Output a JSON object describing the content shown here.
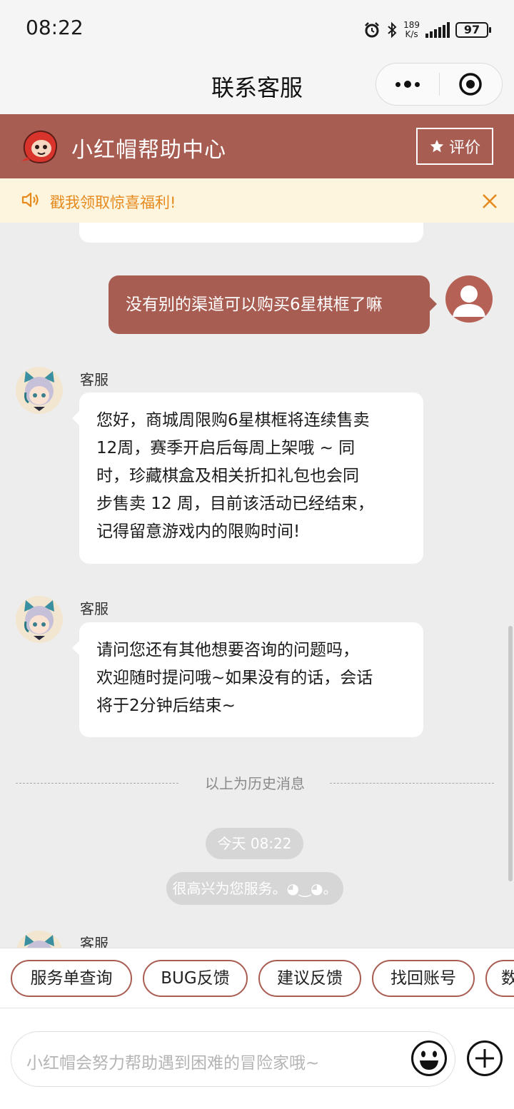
{
  "status_bar": {
    "time": "08:22",
    "net_speed_value": "189",
    "net_speed_unit": "K/s",
    "battery": "97",
    "icons": [
      "alarm-icon",
      "bluetooth-icon",
      "signal-icon",
      "battery-icon"
    ]
  },
  "title_bar": {
    "title": "联系客服",
    "icons": [
      "more-icon",
      "close-target-icon"
    ]
  },
  "brand": {
    "title": "小红帽帮助中心",
    "rate_label": "评价",
    "accent_color": "#a85d52"
  },
  "notice": {
    "text": "戳我领取惊喜福利!",
    "text_color": "#e68a1e",
    "background": "#fdf5dd"
  },
  "chat": {
    "user_message": "没有别的渠道可以购买6星棋框了嘛",
    "messages": [
      {
        "sender": "客服",
        "lines": [
          "您好，商城周限购6星棋框将连续售卖",
          "12周，赛季开启后每周上架哦 ~ 同",
          "时，珍藏棋盒及相关折扣礼包也会同",
          "步售卖 12 周，目前该活动已经结束，",
          "记得留意游戏内的限购时间!"
        ]
      },
      {
        "sender": "客服",
        "lines": [
          "请问您还有其他想要咨询的问题吗，",
          "欢迎随时提问哦~如果没有的话，会话",
          "将于2分钟后结束~"
        ]
      }
    ],
    "history_divider": "以上为历史消息",
    "time_label": "今天 08:22",
    "greeting": "很高兴为您服务。◕‿◕。",
    "partial_sender": "客服"
  },
  "quick_replies": [
    "服务单查询",
    "BUG反馈",
    "建议反馈",
    "找回账号",
    "数"
  ],
  "input": {
    "placeholder": "小红帽会努力帮助遇到困难的冒险家哦~"
  }
}
